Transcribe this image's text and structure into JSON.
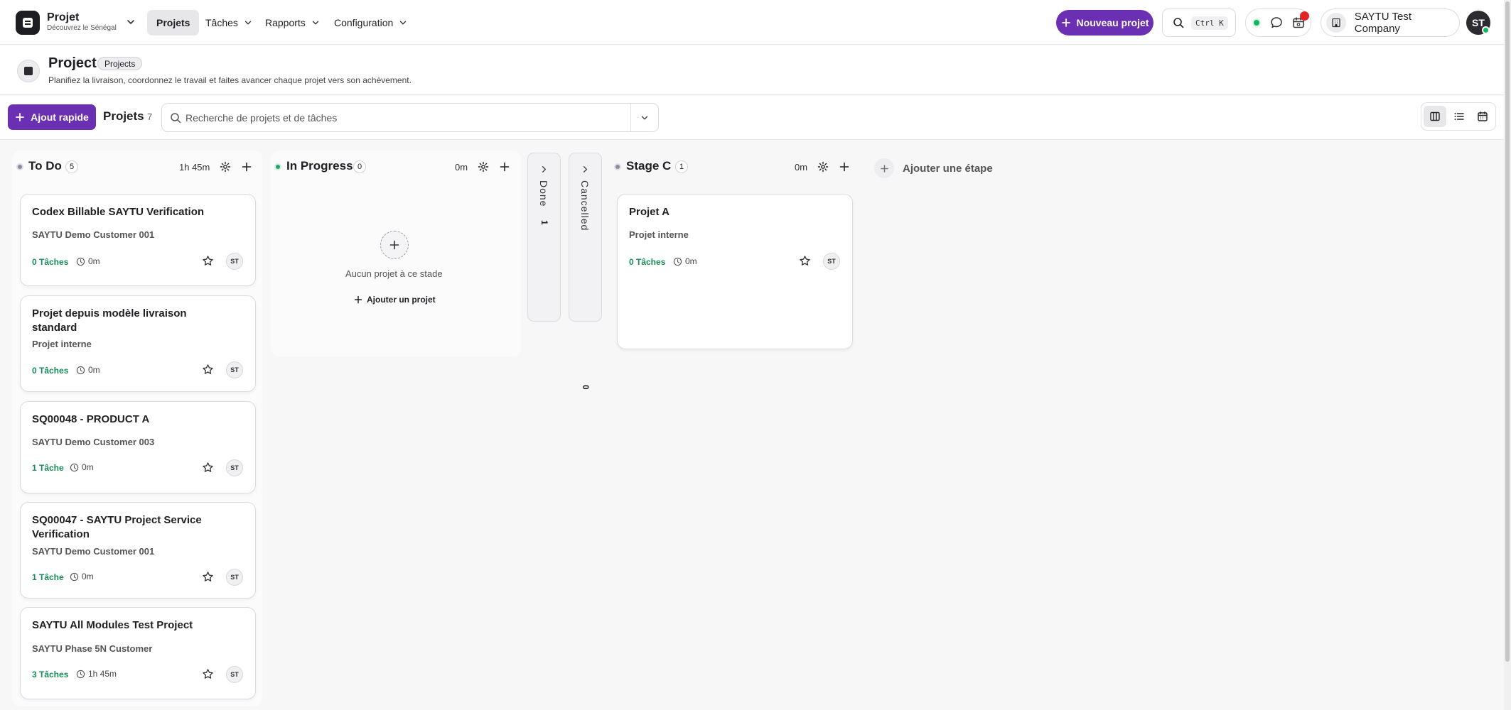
{
  "app": {
    "name": "Projet",
    "subtitle": "Découvrez le Sénégal"
  },
  "nav": {
    "projects": "Projets",
    "tasks": "Tâches",
    "reports": "Rapports",
    "configuration": "Configuration"
  },
  "header_actions": {
    "new_project": "Nouveau projet",
    "shortcut": "Ctrl K",
    "company": "SAYTU Test Company",
    "avatar": "ST"
  },
  "page": {
    "title": "Project",
    "badge": "Projects",
    "subtitle": "Planifiez la livraison, coordonnez le travail et faites avancer chaque projet vers son achèvement."
  },
  "toolbar": {
    "quick_add": "Ajout rapide",
    "projects_label": "Projets",
    "projects_count": "7",
    "search_placeholder": "Recherche de projets et de tâches"
  },
  "columns": {
    "todo": {
      "title": "To Do",
      "count": "5",
      "time": "1h 45m",
      "cards": [
        {
          "title": "Codex Billable SAYTU Verification",
          "sub": "SAYTU Demo Customer 001",
          "tasks": "0 Tâches",
          "time": "0m",
          "user": "ST"
        },
        {
          "title": "Projet depuis modèle livraison standard",
          "sub": "Projet interne",
          "tasks": "0 Tâches",
          "time": "0m",
          "user": "ST"
        },
        {
          "title": "SQ00048 - PRODUCT A",
          "sub": "SAYTU Demo Customer 003",
          "tasks": "1 Tâche",
          "time": "0m",
          "user": "ST"
        },
        {
          "title": "SQ00047 - SAYTU Project Service Verification",
          "sub": "SAYTU Demo Customer 001",
          "tasks": "1 Tâche",
          "time": "0m",
          "user": "ST"
        },
        {
          "title": "SAYTU All Modules Test Project",
          "sub": "SAYTU Phase 5N Customer",
          "tasks": "3 Tâches",
          "time": "1h 45m",
          "user": "ST"
        }
      ]
    },
    "inprogress": {
      "title": "In Progress",
      "count": "0",
      "time": "0m",
      "empty_text": "Aucun projet à ce stade",
      "add_project": "Ajouter un projet"
    },
    "done": {
      "title": "Done",
      "count": "1"
    },
    "cancelled": {
      "title": "Cancelled",
      "count": "0"
    },
    "stagec": {
      "title": "Stage C",
      "count": "1",
      "time": "0m",
      "cards": [
        {
          "title": "Projet A",
          "sub": "Projet interne",
          "tasks": "0 Tâches",
          "time": "0m",
          "user": "ST"
        }
      ]
    }
  },
  "add_stage": "Ajouter une étape",
  "colors": {
    "accent": "#6b2fb3",
    "success": "#178a57",
    "online": "#12b760",
    "notification": "#e02424"
  },
  "icons": [
    "chevron-down-icon",
    "search-icon",
    "chat-icon",
    "calendar-icon",
    "building-icon",
    "plus-icon",
    "gear-icon",
    "star-icon",
    "clock-icon",
    "kanban-icon",
    "list-icon",
    "chevron-right-icon"
  ]
}
